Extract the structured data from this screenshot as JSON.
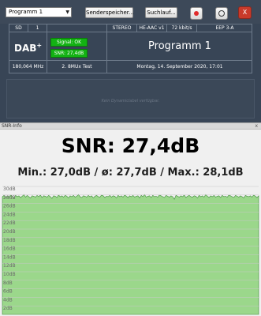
{
  "toolbar": {
    "program_select": "Programm 1",
    "station_memory_button": "Senderspeicher...",
    "search_button": "Suchlauf...",
    "close_label": "X"
  },
  "info": {
    "sd": "SD",
    "sd_number": "1",
    "stereo": "STEREO",
    "codec": "HE-AAC v1",
    "bitrate": "72 kbit/s",
    "eep": "EEP 3-A",
    "logo_text": "DAB",
    "logo_plus": "+",
    "signal_status": "Signal: OK",
    "snr_status": "SNR: 27,4dB",
    "program_name": "Programm 1",
    "frequency": "180,064 MHz",
    "mux": "2. 8MUx Test",
    "datetime": "Montag, 14. September 2020, 17:01"
  },
  "dls": {
    "text": "Kein Dynamiclabel verfügbar."
  },
  "snr_window": {
    "title": "SNR-Info",
    "close_label": "x",
    "snr_value": "SNR: 27,4dB",
    "stats": "Min.: 27,0dB / ø: 27,7dB / Max.: 28,1dB"
  },
  "chart_data": {
    "type": "area",
    "title": "",
    "xlabel": "",
    "ylabel": "",
    "ylim": [
      0,
      30
    ],
    "y_ticks": [
      "30dB",
      "28dB",
      "26dB",
      "24dB",
      "22dB",
      "20dB",
      "18dB",
      "16dB",
      "14dB",
      "12dB",
      "10dB",
      "8dB",
      "6dB",
      "4dB",
      "2dB"
    ],
    "grid": true,
    "fill_color": "#9bd78b",
    "series": [
      {
        "values": [
          27.6,
          27.9,
          27.4,
          27.8,
          27.5,
          28.0,
          27.7,
          27.3,
          27.9,
          27.6,
          27.8,
          27.4,
          27.7,
          28.1,
          27.5,
          27.9,
          27.6,
          27.3,
          27.8,
          27.7,
          27.5,
          27.9,
          27.6,
          28.0,
          27.4,
          27.8,
          27.7,
          27.5,
          27.9,
          27.6,
          27.2,
          27.8,
          27.7,
          27.4,
          28.0,
          27.6,
          27.8,
          27.5,
          27.9,
          27.7,
          27.3,
          27.8,
          27.6,
          27.9,
          27.5,
          27.7,
          28.1,
          27.6,
          27.4,
          27.8,
          27.7,
          27.5,
          27.9,
          27.6,
          27.8,
          27.3,
          27.7,
          27.9,
          27.6,
          27.5,
          28.0,
          27.8,
          27.4,
          27.7,
          27.6,
          27.9,
          27.5,
          27.8,
          27.7,
          27.3,
          27.9,
          27.6,
          27.8,
          27.5,
          28.0,
          27.7,
          27.4,
          27.8,
          27.6,
          27.9,
          27.5,
          27.7,
          27.8,
          27.3,
          27.9,
          27.6,
          28.1,
          27.5,
          27.7,
          27.8,
          27.4,
          27.9,
          27.6,
          27.7,
          27.5,
          28.0,
          27.8,
          27.6,
          27.4,
          27.9,
          27.7,
          27.5,
          27.8,
          27.6,
          27.0,
          27.9,
          27.7,
          27.5,
          27.8,
          27.6,
          28.0,
          27.4,
          27.7,
          27.9,
          27.6,
          27.5,
          27.8,
          27.7,
          27.3,
          27.9,
          27.6,
          27.8,
          27.5,
          28.1,
          27.7,
          27.4,
          27.8,
          27.6,
          27.9,
          27.5,
          27.7,
          27.8,
          27.4,
          27.9,
          27.6,
          27.7,
          27.5,
          28.0,
          27.8,
          27.6,
          27.4,
          27.9,
          27.7,
          27.5,
          27.8,
          27.6,
          27.3,
          27.9,
          27.7,
          27.6,
          27.8,
          27.5,
          28.0,
          27.7,
          27.4,
          27.8
        ]
      }
    ]
  }
}
